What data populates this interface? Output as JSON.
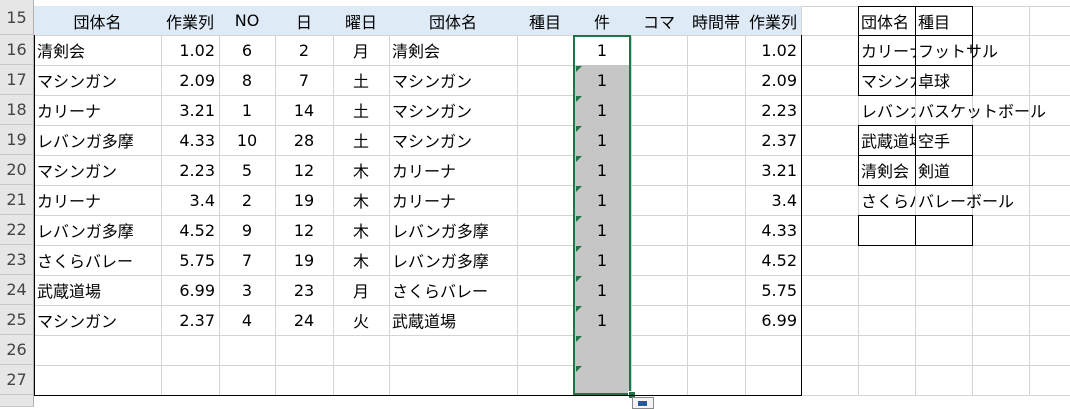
{
  "row_headers": [
    "15",
    "16",
    "17",
    "18",
    "19",
    "20",
    "21",
    "22",
    "23",
    "24",
    "25",
    "26",
    "27"
  ],
  "main_table": {
    "headers": [
      "団体名",
      "作業列",
      "NO",
      "日",
      "曜日",
      "団体名",
      "種目",
      "件",
      "コマ",
      "時間帯",
      "作業列"
    ],
    "rows": [
      {
        "group": "清剣会",
        "work": "1.02",
        "no": "6",
        "day": "2",
        "weekday": "月",
        "group2": "清剣会",
        "event": "",
        "count": "1",
        "koma": "",
        "timeslot": "",
        "work2": "1.02"
      },
      {
        "group": "マシンガン",
        "work": "2.09",
        "no": "8",
        "day": "7",
        "weekday": "土",
        "group2": "マシンガン",
        "event": "",
        "count": "1",
        "koma": "",
        "timeslot": "",
        "work2": "2.09"
      },
      {
        "group": "カリーナ",
        "work": "3.21",
        "no": "1",
        "day": "14",
        "weekday": "土",
        "group2": "マシンガン",
        "event": "",
        "count": "1",
        "koma": "",
        "timeslot": "",
        "work2": "2.23"
      },
      {
        "group": "レバンガ多摩",
        "work": "4.33",
        "no": "10",
        "day": "28",
        "weekday": "土",
        "group2": "マシンガン",
        "event": "",
        "count": "1",
        "koma": "",
        "timeslot": "",
        "work2": "2.37"
      },
      {
        "group": "マシンガン",
        "work": "2.23",
        "no": "5",
        "day": "12",
        "weekday": "木",
        "group2": "カリーナ",
        "event": "",
        "count": "1",
        "koma": "",
        "timeslot": "",
        "work2": "3.21"
      },
      {
        "group": "カリーナ",
        "work": "3.4",
        "no": "2",
        "day": "19",
        "weekday": "木",
        "group2": "カリーナ",
        "event": "",
        "count": "1",
        "koma": "",
        "timeslot": "",
        "work2": "3.4"
      },
      {
        "group": "レバンガ多摩",
        "work": "4.52",
        "no": "9",
        "day": "12",
        "weekday": "木",
        "group2": "レバンガ多摩",
        "event": "",
        "count": "1",
        "koma": "",
        "timeslot": "",
        "work2": "4.33"
      },
      {
        "group": "さくらバレー",
        "work": "5.75",
        "no": "7",
        "day": "19",
        "weekday": "木",
        "group2": "レバンガ多摩",
        "event": "",
        "count": "1",
        "koma": "",
        "timeslot": "",
        "work2": "4.52"
      },
      {
        "group": "武蔵道場",
        "work": "6.99",
        "no": "3",
        "day": "23",
        "weekday": "月",
        "group2": "さくらバレー",
        "event": "",
        "count": "1",
        "koma": "",
        "timeslot": "",
        "work2": "5.75"
      },
      {
        "group": "マシンガン",
        "work": "2.37",
        "no": "4",
        "day": "24",
        "weekday": "火",
        "group2": "武蔵道場",
        "event": "",
        "count": "1",
        "koma": "",
        "timeslot": "",
        "work2": "6.99"
      },
      {
        "group": "",
        "work": "",
        "no": "",
        "day": "",
        "weekday": "",
        "group2": "",
        "event": "",
        "count": "",
        "koma": "",
        "timeslot": "",
        "work2": ""
      },
      {
        "group": "",
        "work": "",
        "no": "",
        "day": "",
        "weekday": "",
        "group2": "",
        "event": "",
        "count": "",
        "koma": "",
        "timeslot": "",
        "work2": ""
      }
    ]
  },
  "side_table": {
    "headers": [
      "団体名",
      "種目"
    ],
    "rows": [
      {
        "group": "カリーナ",
        "event": "フットサル"
      },
      {
        "group": "マシンガン",
        "event": "卓球"
      },
      {
        "group": "レバンガ多摩",
        "event": "バスケットボール"
      },
      {
        "group": "武蔵道場",
        "event": "空手"
      },
      {
        "group": "清剣会",
        "event": "剣道"
      },
      {
        "group": "さくらバレー",
        "event": "バレーボール"
      },
      {
        "group": "",
        "event": ""
      }
    ]
  },
  "colors": {
    "header_fill": "#deebf7",
    "selection_fill": "#c6c6c6",
    "selection_border": "#217346",
    "row_header_bg": "#e6e6e6"
  }
}
